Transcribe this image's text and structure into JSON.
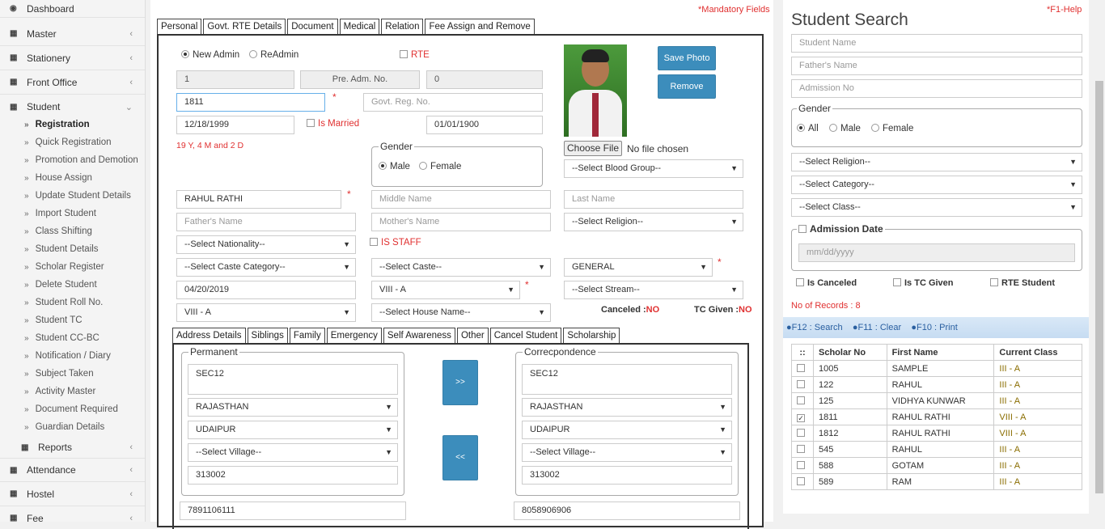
{
  "sidebar": {
    "dashboard": "Dashboard",
    "master": "Master",
    "stationery": "Stationery",
    "front_office": "Front Office",
    "student": "Student",
    "sub_items": [
      "Registration",
      "Quick Registration",
      "Promotion and Demotion",
      "House Assign",
      "Update Student Details",
      "Import Student",
      "Class Shifting",
      "Student Details",
      "Scholar Register",
      "Delete Student",
      "Student Roll No.",
      "Student TC",
      "Student CC-BC",
      "Notification / Diary",
      "Subject Taken",
      "Activity Master",
      "Document Required",
      "Guardian Details"
    ],
    "reports": "Reports",
    "attendance": "Attendance",
    "hostel": "Hostel",
    "fee": "Fee"
  },
  "form": {
    "mandatory": "*Mandatory Fields",
    "tabs": [
      "Personal",
      "Govt. RTE Details",
      "Document",
      "Medical",
      "Relation",
      "Fee Assign and Remove"
    ],
    "new_admin": "New Admin",
    "readmin": "ReAdmin",
    "rte": "RTE",
    "admission_field": "1",
    "pre_adm_placeholder": "Pre. Adm. No.",
    "pre_adm_value": "0",
    "scholar_no": "1811",
    "govt_reg_placeholder": "Govt. Reg. No.",
    "dob": "12/18/1999",
    "is_married": "Is Married",
    "marriage_date": "01/01/1900",
    "age_text": "19 Y, 4 M and 2 D",
    "gender_legend": "Gender",
    "male": "Male",
    "female": "Female",
    "save_photo": "Save Photo",
    "remove": "Remove",
    "choose_file": "Choose File",
    "no_file": "No file chosen",
    "blood_group": "--Select Blood Group--",
    "first_name": "RAHUL RATHI",
    "middle_placeholder": "Middle Name",
    "last_placeholder": "Last Name",
    "father_placeholder": "Father's Name",
    "mother_placeholder": "Mother's Name",
    "religion": "--Select Religion--",
    "nationality": "--Select Nationality--",
    "is_staff": "IS STAFF",
    "caste_category": "--Select Caste Category--",
    "caste": "--Select Caste--",
    "category_value": "GENERAL",
    "admission_date": "04/20/2019",
    "class_value": "VIII - A",
    "stream": "--Select Stream--",
    "section_value": "VIII - A",
    "house": "--Select House Name--",
    "canceled_label": "Canceled :",
    "canceled_value": "NO",
    "tc_label": "TC Given :",
    "tc_value": "NO",
    "sub_tabs": [
      "Address Details",
      "Siblings",
      "Family",
      "Emergency",
      "Self Awareness",
      "Other",
      "Cancel Student",
      "Scholarship"
    ],
    "permanent": "Permanent",
    "correspondence": "Correcpondence",
    "perm_address": "SEC12",
    "perm_state": "RAJASTHAN",
    "perm_city": "UDAIPUR",
    "perm_village": "--Select Village--",
    "perm_pin": "313002",
    "corr_address": "SEC12",
    "corr_state": "RAJASTHAN",
    "corr_city": "UDAIPUR",
    "corr_village": "--Select Village--",
    "corr_pin": "313002",
    "copy_right": ">>",
    "copy_left": "<<",
    "phone1": "7891106111",
    "phone2": "8058906906"
  },
  "search": {
    "help": "*F1-Help",
    "title": "Student Search",
    "student_name": "Student Name",
    "father_name": "Father's Name",
    "admission_no": "Admission No",
    "gender_legend": "Gender",
    "all": "All",
    "male": "Male",
    "female": "Female",
    "religion": "--Select Religion--",
    "category": "--Select Category--",
    "class": "--Select Class--",
    "admission_date": "Admission Date",
    "date_placeholder": "mm/dd/yyyy",
    "is_canceled": "Is Canceled",
    "is_tc": "Is TC Given",
    "rte_student": "RTE Student",
    "records": "No of Records : 8",
    "f12": "F12 : Search",
    "f11": "F11 : Clear",
    "f10": "F10 : Print",
    "col_scholar": "Scholar No",
    "col_first": "First Name",
    "col_class": "Current Class",
    "rows": [
      {
        "no": "1005",
        "name": "SAMPLE",
        "cls": "III - A",
        "checked": false
      },
      {
        "no": "122",
        "name": "RAHUL",
        "cls": "III - A",
        "checked": false
      },
      {
        "no": "125",
        "name": "VIDHYA KUNWAR",
        "cls": "III - A",
        "checked": false
      },
      {
        "no": "1811",
        "name": "RAHUL RATHI",
        "cls": "VIII - A",
        "checked": true
      },
      {
        "no": "1812",
        "name": "RAHUL RATHI",
        "cls": "VIII - A",
        "checked": false
      },
      {
        "no": "545",
        "name": "RAHUL",
        "cls": "III - A",
        "checked": false
      },
      {
        "no": "588",
        "name": "GOTAM",
        "cls": "III - A",
        "checked": false
      },
      {
        "no": "589",
        "name": "RAM",
        "cls": "III - A",
        "checked": false
      }
    ]
  }
}
